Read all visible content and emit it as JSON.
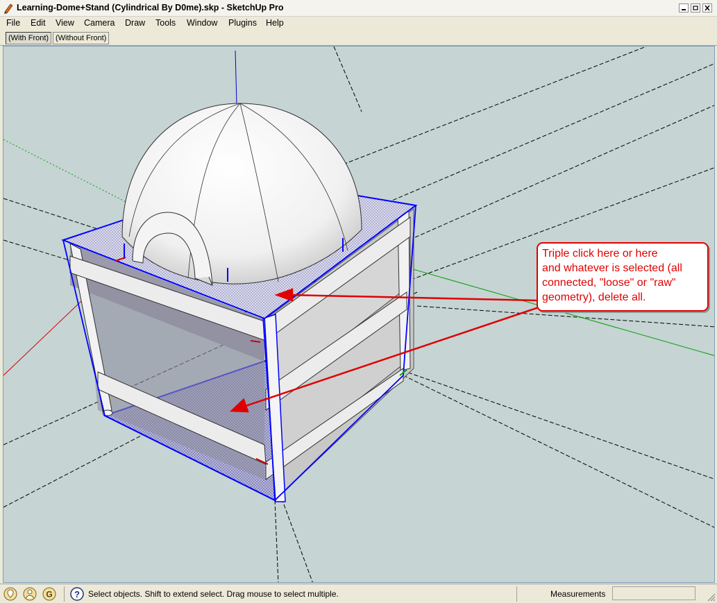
{
  "window": {
    "title": "Learning-Dome+Stand (Cylindrical By D0me).skp - SketchUp Pro",
    "app_icon": "pencil-icon",
    "controls": [
      "minimize-icon",
      "maximize-icon",
      "close-icon"
    ]
  },
  "menu": [
    "File",
    "Edit",
    "View",
    "Camera",
    "Draw",
    "Tools",
    "Window",
    "Plugins",
    "Help"
  ],
  "scene_tabs": [
    {
      "label": "(With Front)",
      "active": true
    },
    {
      "label": "(Without Front)",
      "active": false
    }
  ],
  "callout": {
    "lines": [
      "Triple click here or here",
      "and whatever is selected (all",
      "connected, \"loose\" or \"raw\"",
      "geometry), delete all."
    ],
    "color": "#e00000"
  },
  "status": {
    "icons": [
      "geo-location-icon",
      "credits-icon",
      "google-sign-in-icon",
      "help-icon"
    ],
    "text": "Select objects. Shift to extend select. Drag mouse to select multiple.",
    "measurements_label": "Measurements",
    "measurements_value": ""
  },
  "colors": {
    "sky": "#c6d4d4",
    "selection": "#0000ff",
    "red_axis": "#d00000",
    "green_axis": "#00a000",
    "blue_axis": "#0000d0"
  }
}
